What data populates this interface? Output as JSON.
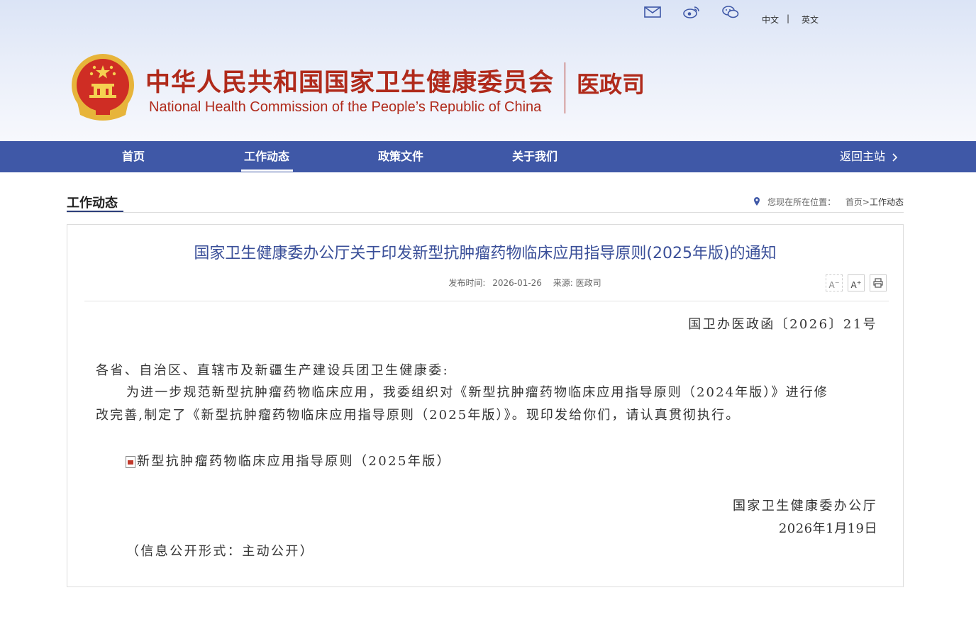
{
  "top_bar": {
    "icons": [
      "mail-icon",
      "weibo-icon",
      "wechat-icon"
    ],
    "lang_cn": "中文",
    "lang_sep": "|",
    "lang_en": "英文"
  },
  "header": {
    "title_cn": "中华人民共和国国家卫生健康委员会",
    "title_en": "National Health Commission of the People’s  Republic of China",
    "department": "医政司",
    "brand_color": "#b02a1b"
  },
  "nav": {
    "items": [
      {
        "label": "首页"
      },
      {
        "label": "工作动态",
        "active": true
      },
      {
        "label": "政策文件"
      },
      {
        "label": "关于我们"
      }
    ],
    "back_label": "返回主站",
    "background": "#3f58a7"
  },
  "section": {
    "title": "工作动态",
    "breadcrumb_prefix": "您现在所在位置：",
    "breadcrumb_home": "首页",
    "breadcrumb_sep": ">",
    "breadcrumb_current": "工作动态"
  },
  "article": {
    "title": "国家卫生健康委办公厅关于印发新型抗肿瘤药物临床应用指导原则(2025年版)的通知",
    "publish_label": "发布时间:",
    "publish_date": "2026-01-26",
    "source_label": "来源:",
    "source": "医政司",
    "tools": [
      "font-decrease-icon",
      "font-increase-icon",
      "print-icon"
    ],
    "doc_number": "国卫办医政函〔2026〕21号",
    "salutation": "各省、自治区、直辖市及新疆生产建设兵团卫生健康委:",
    "para_line1": "为进一步规范新型抗肿瘤药物临床应用，我委组织对《新型抗肿瘤药物临床应用指导原则（2024年版）》进行修",
    "para_line2": "改完善,制定了《新型抗肿瘤药物临床应用指导原则（2025年版）》。现印发给你们，请认真贯彻执行。",
    "attachment": "新型抗肿瘤药物临床应用指导原则（2025年版）",
    "signer": "国家卫生健康委办公厅",
    "sign_date": "2026年1月19日",
    "disclosure": "（信息公开形式：主动公开）"
  }
}
